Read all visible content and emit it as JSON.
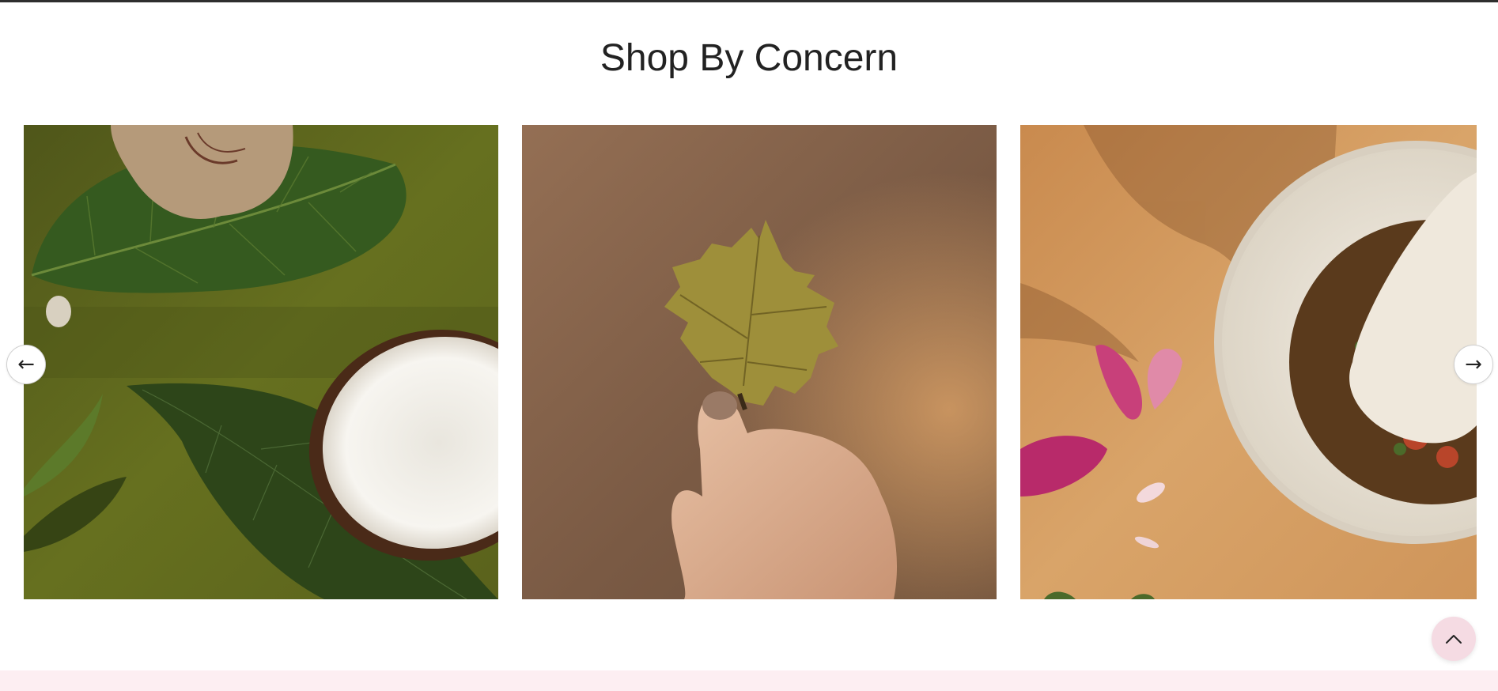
{
  "section": {
    "title": "Shop By Concern"
  },
  "carousel": {
    "prev_icon": "arrow-left-icon",
    "prev_glyph": "←",
    "next_icon": "arrow-right-icon",
    "next_glyph": "→",
    "cards": [
      {
        "image": "neem-leaves-and-coconut-image"
      },
      {
        "image": "hand-holding-leaf-image"
      },
      {
        "image": "mortar-pestle-with-petals-image"
      }
    ]
  },
  "back_to_top": {
    "icon": "chevron-up-icon"
  },
  "colors": {
    "title": "#222222",
    "top_rule": "#2e2e2e",
    "back_to_top_bg": "#f5dbe3",
    "footer_bg": "#fdeef2",
    "olive": "#5d6420",
    "leaf_dark": "#2f4518",
    "coconut_white": "#f2efe8",
    "warm_brown": "#8a6a50",
    "sand": "#d9a469",
    "petal_pink": "#c0316f"
  }
}
